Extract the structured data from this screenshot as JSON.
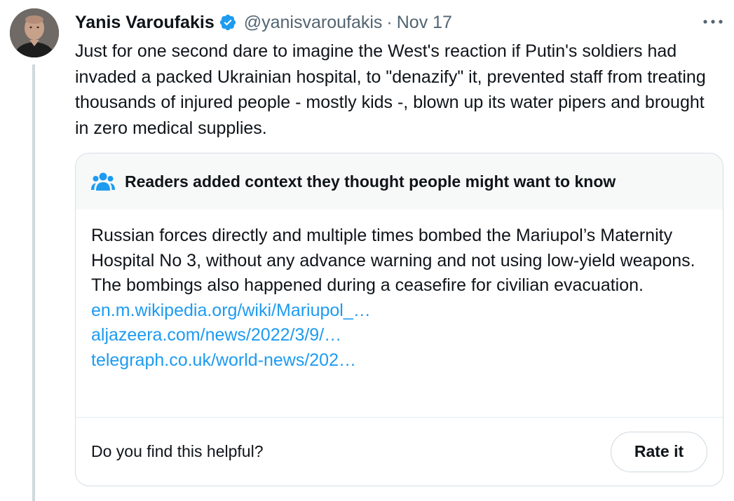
{
  "tweet": {
    "author_name": "Yanis Varoufakis",
    "handle": "@yanisvaroufakis",
    "separator": "·",
    "date": "Nov 17",
    "more_label": "···",
    "text": "Just for one second dare to imagine the West's reaction if Putin's soldiers had invaded a packed Ukrainian hospital, to \"denazify\" it, prevented staff from treating thousands of injured people - mostly kids -, blown up its water pipers and brought in zero medical supplies."
  },
  "community_note": {
    "title": "Readers added context they thought people might want to know",
    "body": "Russian forces directly and multiple times bombed the Mariupol’s Maternity Hospital No 3, without any advance warning and not using low-yield weapons. The bombings also happened during a ceasefire for civilian evacuation.",
    "links": [
      "en.m.wikipedia.org/wiki/Mariupol_…",
      "aljazeera.com/news/2022/3/9/…",
      "telegraph.co.uk/world-news/202…"
    ],
    "helpful_prompt": "Do you find this helpful?",
    "rate_label": "Rate it"
  },
  "colors": {
    "link": "#1d9bf0",
    "verified_badge": "#1d9bf0",
    "secondary_text": "#536471",
    "primary_text": "#0f1419",
    "thread_line": "#cfd9de"
  },
  "icons": {
    "verified": "verified-badge-icon",
    "community": "people-icon",
    "more": "more-icon"
  }
}
